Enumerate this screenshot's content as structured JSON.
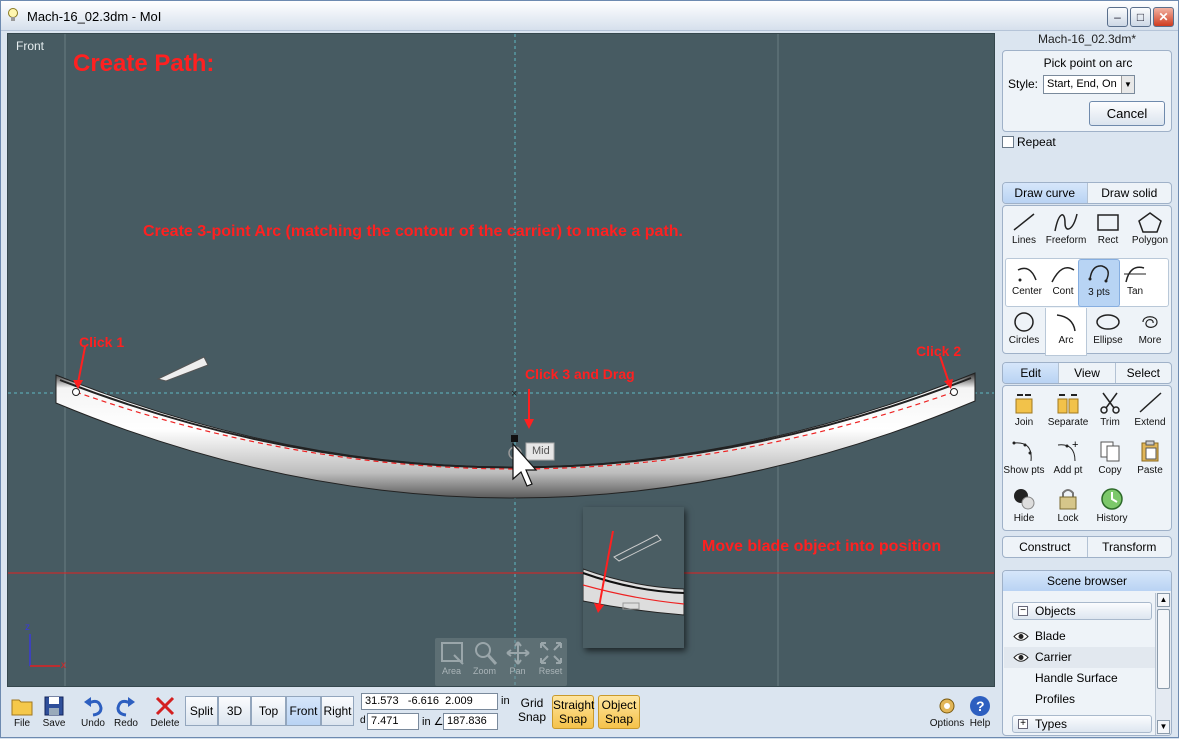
{
  "window": {
    "title": "Mach-16_02.3dm - MoI",
    "minimize": "–",
    "maximize": "□",
    "close": "✕"
  },
  "viewport": {
    "label": "Front",
    "annotations": {
      "create_path": "Create Path:",
      "instruction": "Create 3-point Arc (matching the contour of the carrier) to make a path.",
      "click1": "Click 1",
      "click2": "Click 2",
      "click3": "Click 3 and Drag",
      "move_blade": "Move blade object into position"
    },
    "snap_label": "Mid",
    "axes": {
      "z": "z",
      "x": "x"
    },
    "nav": [
      {
        "label": "Area",
        "icon": "area-icon"
      },
      {
        "label": "Zoom",
        "icon": "zoom-icon"
      },
      {
        "label": "Pan",
        "icon": "pan-icon"
      },
      {
        "label": "Reset",
        "icon": "reset-icon"
      }
    ]
  },
  "panel": {
    "filename": "Mach-16_02.3dm*",
    "command": {
      "prompt": "Pick point on arc",
      "style_label": "Style:",
      "style_value": "Start, End, On",
      "cancel": "Cancel",
      "repeat": "Repeat"
    },
    "draw_tabs": [
      "Draw curve",
      "Draw solid"
    ],
    "curve_tools": [
      "Lines",
      "Freeform",
      "Rect",
      "Polygon"
    ],
    "arc_tools": [
      "Center",
      "Cont",
      "3 pts",
      "Tan"
    ],
    "shape_tools": [
      "Circles",
      "Arc",
      "Ellipse",
      "More"
    ],
    "edit_tabs": [
      "Edit",
      "View",
      "Select"
    ],
    "edit_tools": [
      "Join",
      "Separate",
      "Trim",
      "Extend",
      "Show pts",
      "Add pt",
      "Copy",
      "Paste",
      "Hide",
      "Lock",
      "History"
    ],
    "bottom_tabs": [
      "Construct",
      "Transform"
    ],
    "scene": {
      "title": "Scene browser",
      "objects_header": "Objects",
      "objects_toggle": "−",
      "items": [
        "Blade",
        "Carrier",
        "Handle Surface",
        "Profiles"
      ],
      "types_header": "Types",
      "types_toggle": "+"
    }
  },
  "bottombar": {
    "file_buttons": [
      "File",
      "Save",
      "Undo",
      "Redo",
      "Delete"
    ],
    "views": [
      "Split",
      "3D",
      "Top",
      "Front",
      "Right"
    ],
    "active_view": "Front",
    "coords": {
      "x": "31.573",
      "y": "-6.616",
      "z": "2.009",
      "unit": "in",
      "d_label": "d",
      "d": "7.471",
      "d_unit": "in ∠",
      "angle": "187.836"
    },
    "grid_snap": "Grid Snap",
    "straight_snap": "Straight Snap",
    "object_snap": "Object Snap",
    "options": "Options",
    "help": "Help"
  }
}
